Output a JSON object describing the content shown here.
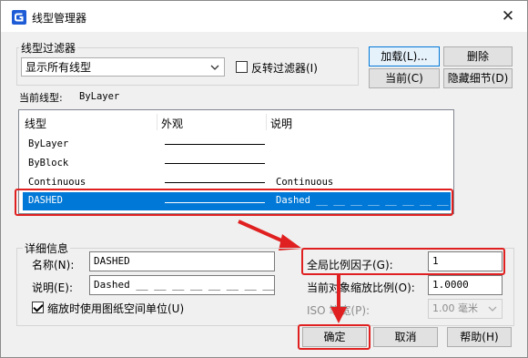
{
  "titlebar": {
    "title": "线型管理器",
    "close_symbol": "✕"
  },
  "filter": {
    "group_label": "线型过滤器",
    "selected": "显示所有线型",
    "invert_label": "反转过滤器(I)",
    "invert_checked": false
  },
  "buttons": {
    "load": "加载(L)...",
    "delete": "删除",
    "current": "当前(C)",
    "hide_details": "隐藏细节(D)",
    "ok": "确定",
    "cancel": "取消",
    "help": "帮助(H)"
  },
  "current_linetype": {
    "label": "当前线型:",
    "value": "ByLayer"
  },
  "table": {
    "headers": [
      "线型",
      "外观",
      "说明"
    ],
    "rows": [
      {
        "name": "ByLayer",
        "description": "",
        "pattern": "solid",
        "selected": false
      },
      {
        "name": "ByBlock",
        "description": "",
        "pattern": "solid",
        "selected": false
      },
      {
        "name": "Continuous",
        "description": "Continuous",
        "pattern": "solid",
        "selected": false
      },
      {
        "name": "DASHED",
        "description": "Dashed __ __ __ __ __ __ __ __",
        "pattern": "dashed",
        "selected": true
      }
    ]
  },
  "details": {
    "group_label": "详细信息",
    "name_label": "名称(N):",
    "name_value": "DASHED",
    "desc_label": "说明(E):",
    "desc_value": "Dashed __ __ __ __ __ __ __ __",
    "paper_units_label": "缩放时使用图纸空间单位(U)",
    "paper_units_checked": true,
    "global_scale_label": "全局比例因子(G):",
    "global_scale_value": "1",
    "current_scale_label": "当前对象缩放比例(O):",
    "current_scale_value": "1.0000",
    "iso_label": "ISO 笔宽(P):",
    "iso_value": "1.00 毫米"
  },
  "colors": {
    "highlight_red": "#e02020",
    "selection_blue": "#0078d7",
    "app_icon_blue": "#1e5bd6"
  }
}
